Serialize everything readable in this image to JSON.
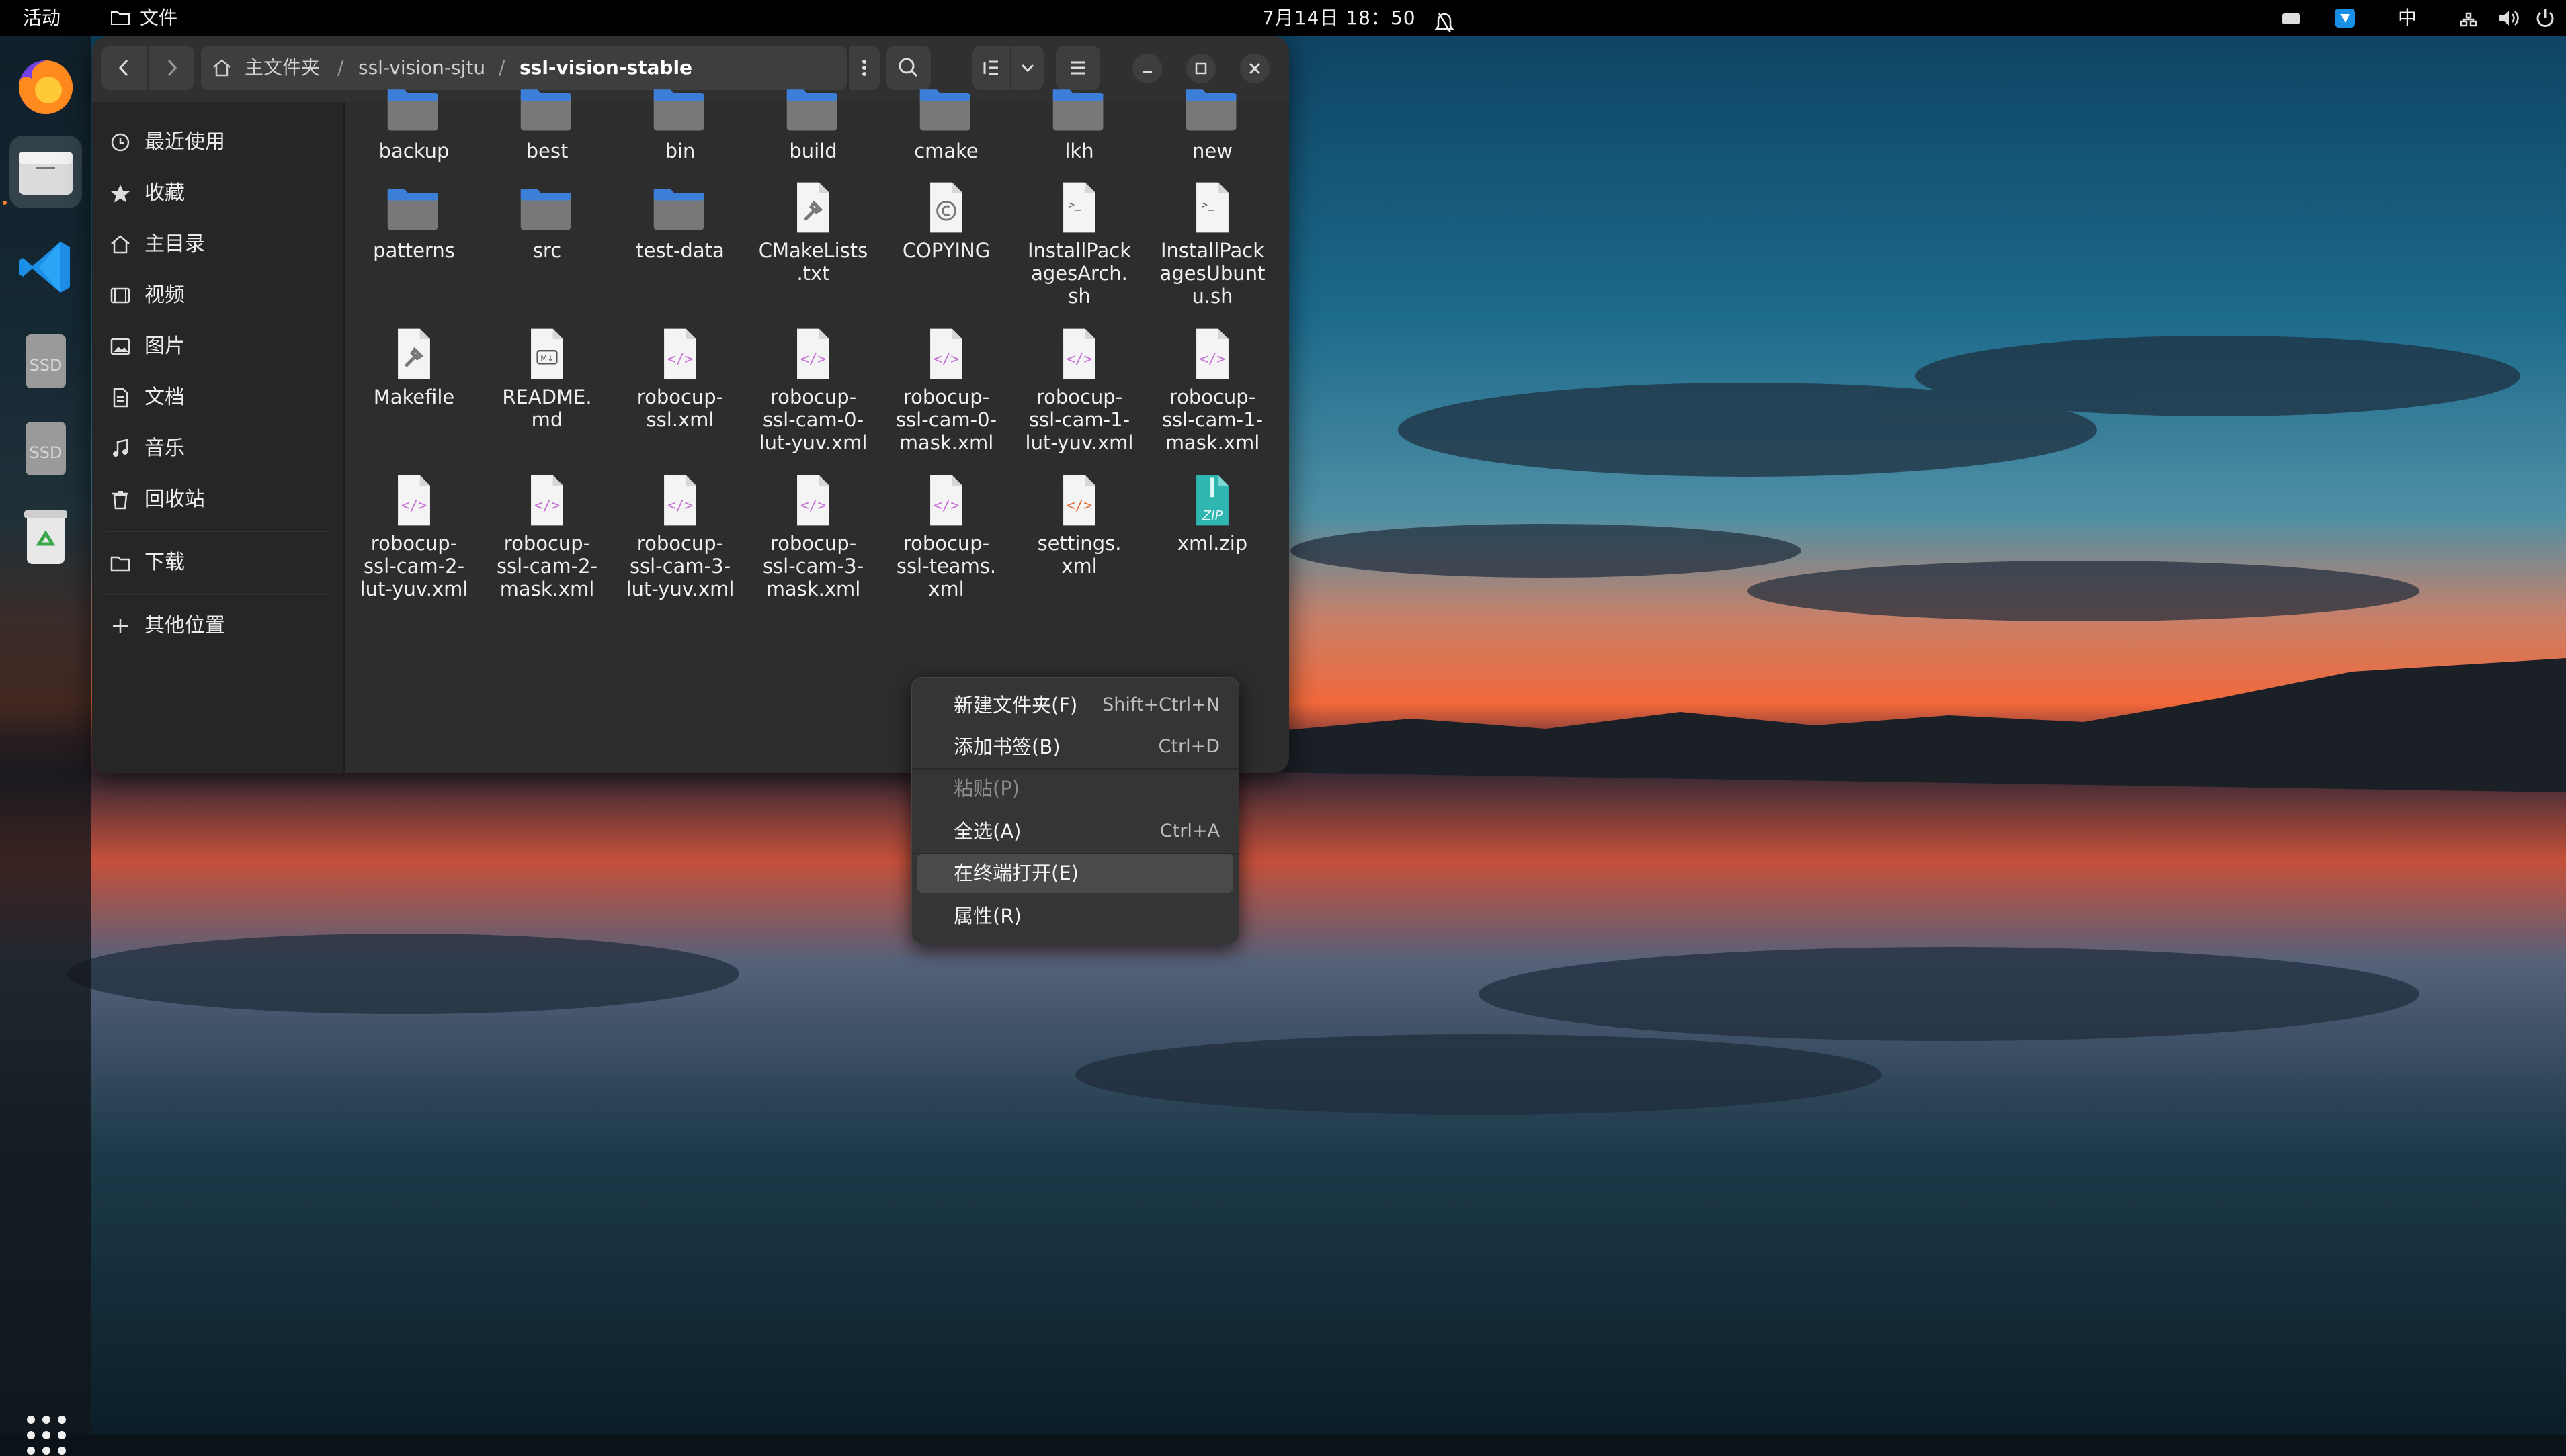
{
  "topbar": {
    "activities": "活动",
    "app_menu": "文件",
    "clock": "7月14日  18：50",
    "input_method": "中"
  },
  "dock": {
    "items": [
      "firefox-icon",
      "files-icon",
      "vscode-icon",
      "ssd-drive-icon",
      "ssd-drive-icon",
      "trash-icon"
    ],
    "drive_label": "SSD"
  },
  "window": {
    "path": [
      "主文件夹",
      "ssl-vision-sjtu",
      "ssl-vision-stable"
    ],
    "path_separator": "/"
  },
  "sidebar": {
    "items": [
      {
        "label": "最近使用",
        "icon": "clock-icon"
      },
      {
        "label": "收藏",
        "icon": "star-icon"
      },
      {
        "label": "主目录",
        "icon": "home-icon"
      },
      {
        "label": "视频",
        "icon": "video-icon"
      },
      {
        "label": "图片",
        "icon": "image-icon"
      },
      {
        "label": "文档",
        "icon": "document-icon"
      },
      {
        "label": "音乐",
        "icon": "music-icon"
      },
      {
        "label": "回收站",
        "icon": "trash-icon"
      },
      {
        "label": "下载",
        "icon": "folder-icon"
      },
      {
        "label": "其他位置",
        "icon": "plus-icon"
      }
    ]
  },
  "files": [
    {
      "name": "backup",
      "type": "folder"
    },
    {
      "name": "best",
      "type": "folder"
    },
    {
      "name": "bin",
      "type": "folder"
    },
    {
      "name": "build",
      "type": "folder"
    },
    {
      "name": "cmake",
      "type": "folder"
    },
    {
      "name": "lkh",
      "type": "folder"
    },
    {
      "name": "new",
      "type": "folder"
    },
    {
      "name": "patterns",
      "type": "folder"
    },
    {
      "name": "src",
      "type": "folder"
    },
    {
      "name": "test-data",
      "type": "folder"
    },
    {
      "name": "CMakeLists\n.txt",
      "type": "build"
    },
    {
      "name": "COPYING",
      "type": "copyright"
    },
    {
      "name": "InstallPack\nagesArch.\nsh",
      "type": "script"
    },
    {
      "name": "InstallPack\nagesUbunt\nu.sh",
      "type": "script"
    },
    {
      "name": "Makefile",
      "type": "build"
    },
    {
      "name": "README.\nmd",
      "type": "markdown"
    },
    {
      "name": "robocup-\nssl.xml",
      "type": "xml"
    },
    {
      "name": "robocup-\nssl-cam-0-\nlut-yuv.xml",
      "type": "xml"
    },
    {
      "name": "robocup-\nssl-cam-0-\nmask.xml",
      "type": "xml"
    },
    {
      "name": "robocup-\nssl-cam-1-\nlut-yuv.xml",
      "type": "xml"
    },
    {
      "name": "robocup-\nssl-cam-1-\nmask.xml",
      "type": "xml"
    },
    {
      "name": "robocup-\nssl-cam-2-\nlut-yuv.xml",
      "type": "xml"
    },
    {
      "name": "robocup-\nssl-cam-2-\nmask.xml",
      "type": "xml"
    },
    {
      "name": "robocup-\nssl-cam-3-\nlut-yuv.xml",
      "type": "xml"
    },
    {
      "name": "robocup-\nssl-cam-3-\nmask.xml",
      "type": "xml"
    },
    {
      "name": "robocup-\nssl-teams.\nxml",
      "type": "xml"
    },
    {
      "name": "settings.\nxml",
      "type": "xml-alt"
    },
    {
      "name": "xml.zip",
      "type": "zip"
    }
  ],
  "context_menu": {
    "items": [
      {
        "label": "新建文件夹(F)",
        "shortcut": "Shift+Ctrl+N",
        "disabled": false
      },
      {
        "label": "添加书签(B)",
        "shortcut": "Ctrl+D",
        "disabled": false
      },
      {
        "label": "粘贴(P)",
        "shortcut": "",
        "disabled": true
      },
      {
        "label": "全选(A)",
        "shortcut": "Ctrl+A",
        "disabled": false
      },
      {
        "label": "在终端打开(E)",
        "shortcut": "",
        "disabled": false,
        "hover": true
      },
      {
        "label": "属性(R)",
        "shortcut": "",
        "disabled": false
      }
    ]
  },
  "colors": {
    "folder_blue": "#3b7fd9",
    "folder_gray": "#787878",
    "xml_accent": "#c66fd6",
    "zip_teal": "#2fb6b0",
    "sunset_orange": "#f2683a"
  }
}
